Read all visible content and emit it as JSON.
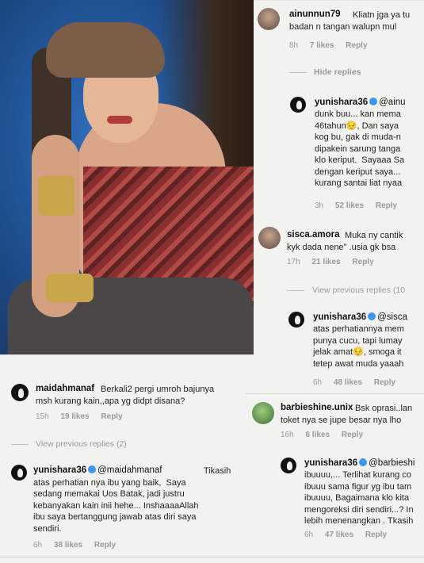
{
  "c1": {
    "user": "ainunnun79",
    "text": "Kliatn jga ya tu\nbadan n tangan walupn mul",
    "time": "8h",
    "likes": "7 likes",
    "reply": "Reply"
  },
  "hide_replies": "Hide replies",
  "r1": {
    "user": "yunishara36",
    "mention": "@ainu",
    "text": "dunk buu... kan mema\n46tahun😔, Dan saya \nkog bu, gak di muda-n\ndipakein sarung tanga\nklo keriput.  Sayaaa Sa\ndengan keriput saya...\nkurang santai liat nyaa",
    "time": "3h",
    "likes": "52 likes",
    "reply": "Reply"
  },
  "c2": {
    "user": "sisca.amora",
    "text": "Muka ny cantik\nkyk dada nene\" .usia gk bsa",
    "time": "17h",
    "likes": "21 likes",
    "reply": "Reply"
  },
  "view_prev_right": "View previous replies (10",
  "r2": {
    "user": "yunishara36",
    "mention": "@sisca",
    "text": "atas perhatiannya mem\npunya cucu, tapi lumay\njelak amat😔, smoga it\ntetep awat muda yaaah",
    "time": "6h",
    "likes": "48 likes",
    "reply": "Reply"
  },
  "c3": {
    "user": "barbieshine.unix",
    "text": "Bsk oprasi..lan\ntoket nya se jupe besar nya lho",
    "time": "16h",
    "likes": "6 likes",
    "reply": "Reply"
  },
  "r3": {
    "user": "yunishara36",
    "mention": "@barbieshi",
    "text": "ibuuuu,... Terlihat kurang co\nibuuu sama figur yg ibu tam\nibuuuu, Bagaimana klo kita\nmengoreksi diri sendiri...? In\nlebih menenangkan . Tkasih",
    "time": "6h",
    "likes": "47 likes",
    "reply": "Reply"
  },
  "c4": {
    "user": "maidahmanaf",
    "text": "Berkali2 pergi umroh bajunya\nmsh kurang kain,,apa yg didpt disana?",
    "time": "15h",
    "likes": "19 likes",
    "reply": "Reply"
  },
  "view_prev_left": "View previous replies (2)",
  "r4": {
    "user": "yunishara36",
    "mention": "@maidahmanaf",
    "text": " Tikasih\natas perhatian nya ibu yang baik,  Saya\nsedang memakai Uos Batak, jadi justru\nkebanyakan kain inii hehe... InshaaaaAllah\nibu saya bertanggung jawab atas diri saya\nsendiri.",
    "time": "6h",
    "likes": "38 likes",
    "reply": "Reply"
  }
}
